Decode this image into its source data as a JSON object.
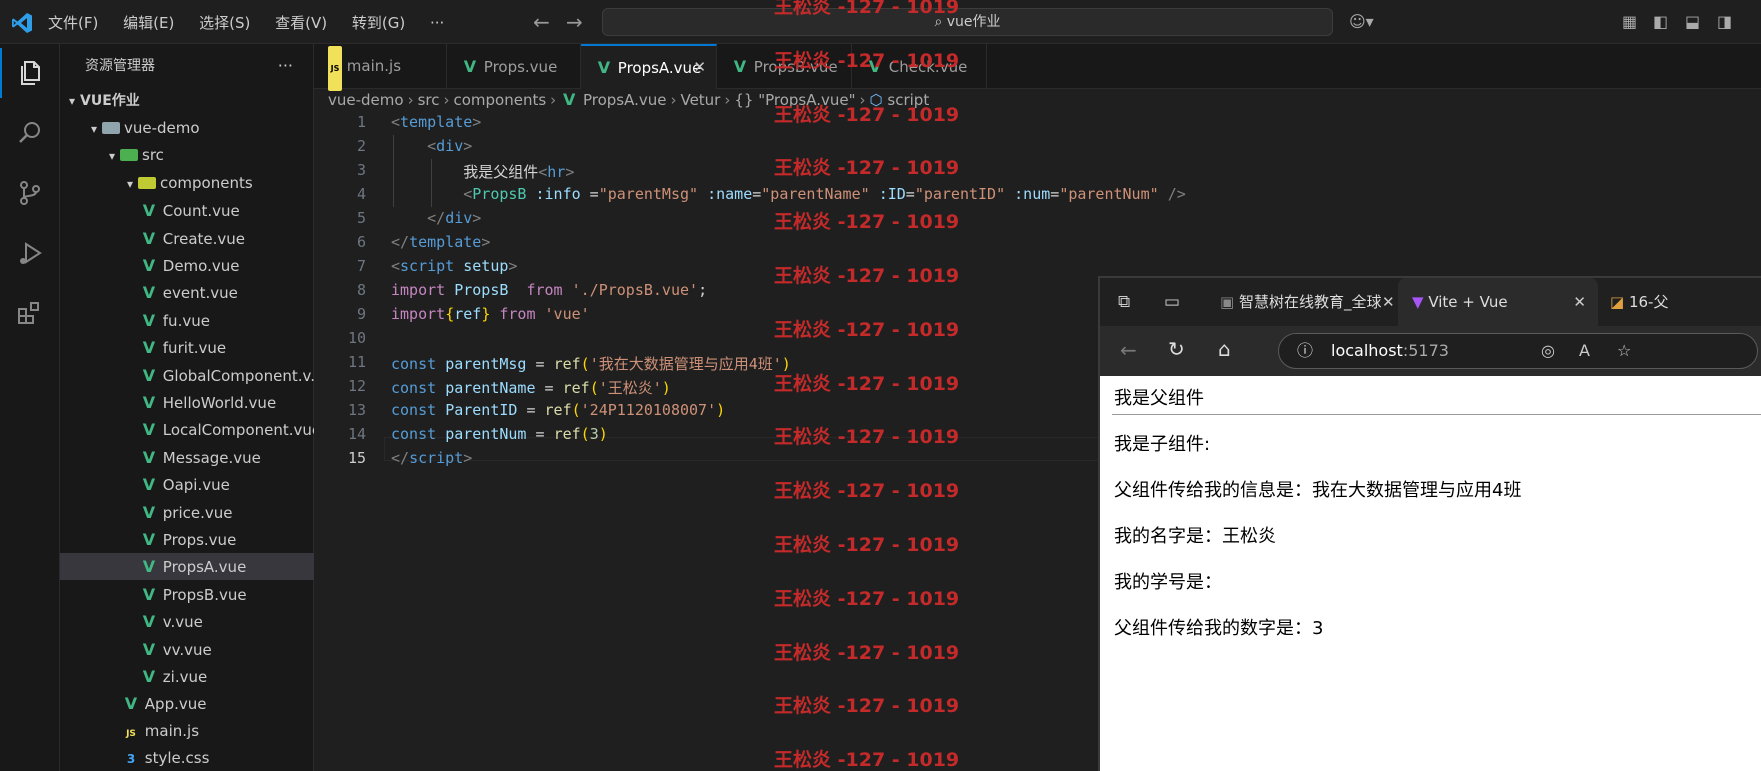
{
  "menu": {
    "items": [
      "文件(F)",
      "编辑(E)",
      "选择(S)",
      "查看(V)",
      "转到(G)"
    ],
    "more": "···"
  },
  "search": {
    "text": "vue作业"
  },
  "sidebar": {
    "title": "资源管理器",
    "root": "VUE作业",
    "tree": [
      {
        "label": "vue-demo",
        "type": "folder",
        "depth": 1
      },
      {
        "label": "src",
        "type": "src",
        "depth": 2
      },
      {
        "label": "components",
        "type": "components",
        "depth": 3
      },
      {
        "label": "Count.vue",
        "type": "vue",
        "depth": 4
      },
      {
        "label": "Create.vue",
        "type": "vue",
        "depth": 4
      },
      {
        "label": "Demo.vue",
        "type": "vue",
        "depth": 4
      },
      {
        "label": "event.vue",
        "type": "vue",
        "depth": 4
      },
      {
        "label": "fu.vue",
        "type": "vue",
        "depth": 4
      },
      {
        "label": "furit.vue",
        "type": "vue",
        "depth": 4
      },
      {
        "label": "GlobalComponent.v...",
        "type": "vue",
        "depth": 4
      },
      {
        "label": "HelloWorld.vue",
        "type": "vue",
        "depth": 4
      },
      {
        "label": "LocalComponent.vue",
        "type": "vue",
        "depth": 4
      },
      {
        "label": "Message.vue",
        "type": "vue",
        "depth": 4
      },
      {
        "label": "Oapi.vue",
        "type": "vue",
        "depth": 4
      },
      {
        "label": "price.vue",
        "type": "vue",
        "depth": 4
      },
      {
        "label": "Props.vue",
        "type": "vue",
        "depth": 4
      },
      {
        "label": "PropsA.vue",
        "type": "vue",
        "depth": 4,
        "selected": true
      },
      {
        "label": "PropsB.vue",
        "type": "vue",
        "depth": 4
      },
      {
        "label": "v.vue",
        "type": "vue",
        "depth": 4
      },
      {
        "label": "vv.vue",
        "type": "vue",
        "depth": 4
      },
      {
        "label": "zi.vue",
        "type": "vue",
        "depth": 4
      },
      {
        "label": "App.vue",
        "type": "vue",
        "depth": 3
      },
      {
        "label": "main.js",
        "type": "js",
        "depth": 3
      },
      {
        "label": "style.css",
        "type": "css",
        "depth": 3
      }
    ]
  },
  "tabs": [
    {
      "label": "main.js",
      "type": "js"
    },
    {
      "label": "Props.vue",
      "type": "vue"
    },
    {
      "label": "PropsA.vue",
      "type": "vue",
      "active": true
    },
    {
      "label": "PropsB.vue",
      "type": "vue"
    },
    {
      "label": "Check.vue",
      "type": "vue"
    }
  ],
  "breadcrumb": [
    "vue-demo",
    "src",
    "components",
    "PropsA.vue",
    "Vetur",
    "\"PropsA.vue\"",
    "script"
  ],
  "editor": {
    "current_line": "15",
    "line_numbers": [
      "1",
      "2",
      "3",
      "4",
      "5",
      "6",
      "7",
      "8",
      "9",
      "10",
      "11",
      "12",
      "13",
      "14",
      "15"
    ],
    "lines": {
      "l1": "template",
      "l2": "div",
      "l3_text": "我是父组件",
      "l3_tag": "hr",
      "l4_comp": "PropsB",
      "l4_a1": ":info",
      "l4_v1": "\"parentMsg\"",
      "l4_a2": ":name",
      "l4_v2": "\"parentName\"",
      "l4_a3": ":ID",
      "l4_v3": "\"parentID\"",
      "l4_a4": ":num",
      "l4_v4": "\"parentNum\"",
      "l5": "div",
      "l6": "template",
      "l7_tag": "script",
      "l7_attr": "setup",
      "l8_kw": "import",
      "l8_name": "PropsB",
      "l8_from": "from",
      "l8_src": "'./PropsB.vue'",
      "l9_kw": "import",
      "l9_name": "ref",
      "l9_from": "from",
      "l9_src": "'vue'",
      "l11_kw": "const",
      "l11_name": "parentMsg",
      "l11_fn": "ref",
      "l11_val": "'我在大数据管理与应用4班'",
      "l12_kw": "const",
      "l12_name": "parentName",
      "l12_fn": "ref",
      "l12_val": "'王松炎'",
      "l13_kw": "const",
      "l13_name": "ParentID",
      "l13_fn": "ref",
      "l13_val": "'24P1120108007'",
      "l14_kw": "const",
      "l14_name": "parentNum",
      "l14_fn": "ref",
      "l14_val": "3",
      "l15": "script"
    }
  },
  "watermark": {
    "text": "王松炎 -127 - 1019",
    "color": "#c42a2a"
  },
  "browser": {
    "tabs": [
      {
        "label": "智慧树在线教育_全球"
      },
      {
        "label": "Vite + Vue",
        "active": true
      },
      {
        "label": "16-父"
      }
    ],
    "url_host": "localhost",
    "url_port": ":5173",
    "content": {
      "parent_title": "我是父组件",
      "child_title": "我是子组件:",
      "info_line": "父组件传给我的信息是：我在大数据管理与应用4班",
      "name_line": "我的名字是：王松炎",
      "id_line": "我的学号是：",
      "num_line": "父组件传给我的数字是：3"
    }
  }
}
